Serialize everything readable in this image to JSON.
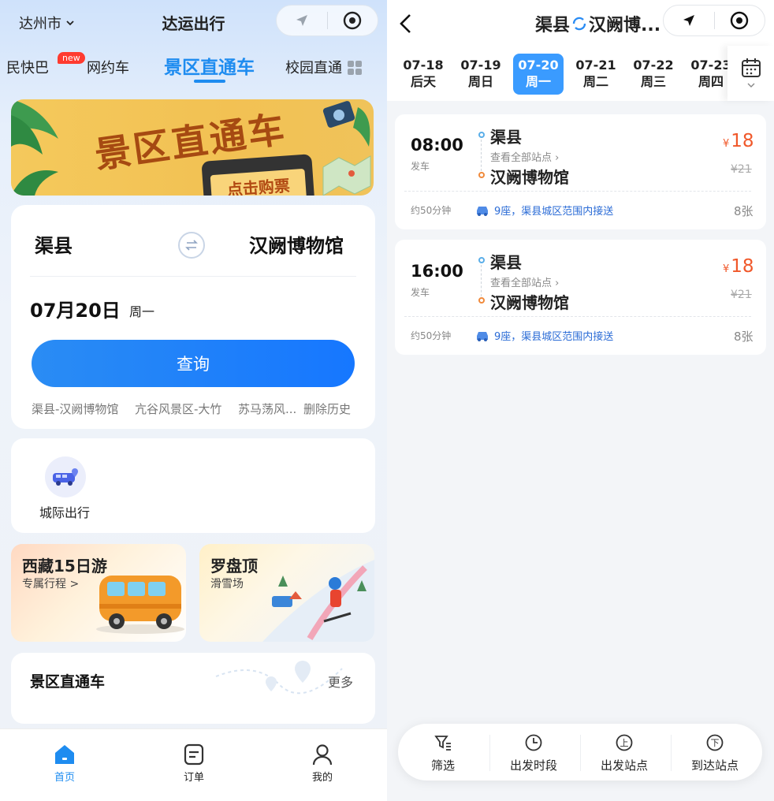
{
  "left": {
    "header": {
      "city": "达州市",
      "title": "达运出行"
    },
    "tabs": [
      {
        "label": "民快巴",
        "badge": "new"
      },
      {
        "label": "网约车"
      },
      {
        "label": "景区直通车",
        "active": true
      },
      {
        "label": "校园直通"
      }
    ],
    "banner": {
      "title": "景区直通车",
      "cta": "点击购票"
    },
    "search": {
      "from": "渠县",
      "to": "汉阙博物馆",
      "date": "07月20日",
      "weekday": "周一",
      "query_label": "查询",
      "history": [
        "渠县-汉阙博物馆",
        "亢谷风景区-大竹",
        "苏马荡风..."
      ],
      "clear_history": "删除历史"
    },
    "services": [
      {
        "label": "城际出行",
        "icon": "bus-location-icon"
      }
    ],
    "promos": [
      {
        "title": "西藏15日游",
        "subtitle": "专属行程 >"
      },
      {
        "title": "罗盘顶",
        "subtitle": "滑雪场"
      }
    ],
    "section": {
      "title": "景区直通车",
      "more": "更多"
    },
    "tabbar": [
      {
        "label": "首页",
        "icon": "home-icon",
        "active": true
      },
      {
        "label": "订单",
        "icon": "order-icon"
      },
      {
        "label": "我的",
        "icon": "profile-icon"
      }
    ],
    "accent": "#1e8cf0"
  },
  "right": {
    "header": {
      "from": "渠县",
      "to": "汉阙博..."
    },
    "dates": [
      {
        "date": "07-18",
        "label": "后天"
      },
      {
        "date": "07-19",
        "label": "周日"
      },
      {
        "date": "07-20",
        "label": "周一",
        "active": true
      },
      {
        "date": "07-21",
        "label": "周二"
      },
      {
        "date": "07-22",
        "label": "周三"
      },
      {
        "date": "07-23",
        "label": "周四"
      }
    ],
    "trips": [
      {
        "time": "08:00",
        "depart": "发车",
        "from": "渠县",
        "all_stops": "查看全部站点",
        "to": "汉阙博物馆",
        "price": "18",
        "currency": "¥",
        "original": "¥21",
        "duration": "约50分钟",
        "seat_info": "9座，渠县城区范围内接送",
        "remaining": "8张"
      },
      {
        "time": "16:00",
        "depart": "发车",
        "from": "渠县",
        "all_stops": "查看全部站点",
        "to": "汉阙博物馆",
        "price": "18",
        "currency": "¥",
        "original": "¥21",
        "duration": "约50分钟",
        "seat_info": "9座，渠县城区范围内接送",
        "remaining": "8张"
      }
    ],
    "filters": [
      {
        "label": "筛选",
        "icon": "filter-icon"
      },
      {
        "label": "出发时段",
        "icon": "clock-icon"
      },
      {
        "label": "出发站点",
        "icon": "boarding-station-icon",
        "glyph": "上"
      },
      {
        "label": "到达站点",
        "icon": "alighting-station-icon",
        "glyph": "下"
      }
    ],
    "price_color": "#f0582a"
  }
}
